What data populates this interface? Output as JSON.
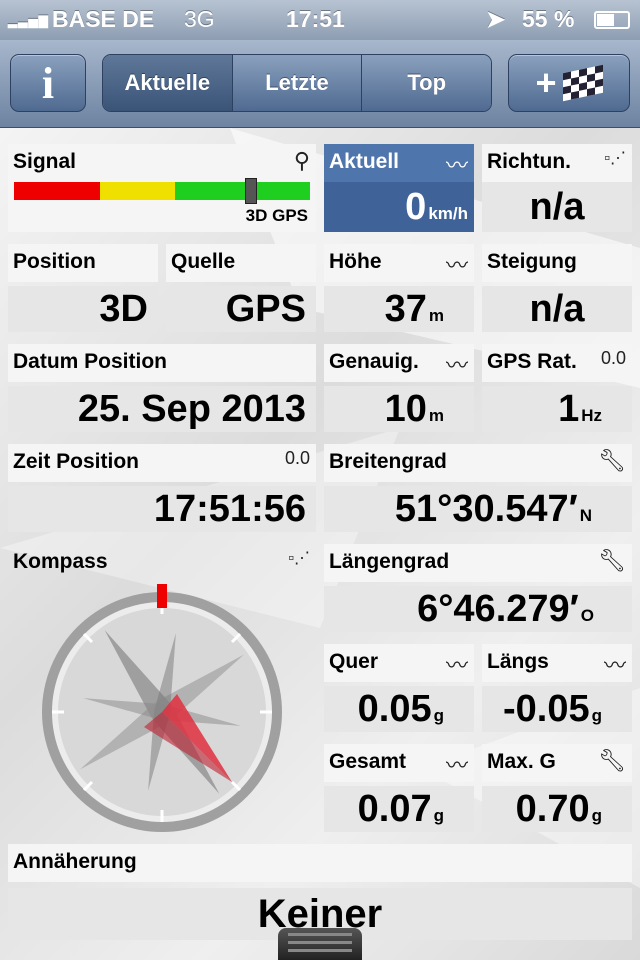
{
  "status_bar": {
    "carrier": "BASE DE",
    "network": "3G",
    "time": "17:51",
    "battery": "55 %"
  },
  "toolbar": {
    "info_label": "i",
    "tabs": [
      "Aktuelle",
      "Letzte",
      "Top"
    ],
    "active_tab": "Aktuelle",
    "add_label": "+"
  },
  "signal": {
    "label": "Signal",
    "status": "3D GPS",
    "level": 0.8
  },
  "speed": {
    "label": "Aktuell",
    "value": "0",
    "unit": "km/h"
  },
  "heading": {
    "label": "Richtun.",
    "value": "n/a"
  },
  "position": {
    "label": "Position",
    "value": "3D"
  },
  "source": {
    "label": "Quelle",
    "value": "GPS"
  },
  "altitude": {
    "label": "Höhe",
    "value": "37",
    "unit": "m"
  },
  "climb": {
    "label": "Steigung",
    "value": "n/a"
  },
  "date_position": {
    "label": "Datum Position",
    "value": "25. Sep 2013"
  },
  "accuracy": {
    "label": "Genauig.",
    "value": "10",
    "unit": "m"
  },
  "gps_rate": {
    "label": "GPS Rat.",
    "badge": "0.0",
    "value": "1",
    "unit": "Hz"
  },
  "time_position": {
    "label": "Zeit Position",
    "badge": "0.0",
    "value": "17:51:56"
  },
  "latitude": {
    "label": "Breitengrad",
    "value": "51°30.547′",
    "unit": "N"
  },
  "compass": {
    "label": "Kompass"
  },
  "longitude": {
    "label": "Längengrad",
    "value": "6°46.279′",
    "unit": "O"
  },
  "lateral": {
    "label": "Quer",
    "value": "0.05",
    "unit": "g"
  },
  "longitudinal": {
    "label": "Längs",
    "value": "-0.05",
    "unit": "g"
  },
  "total": {
    "label": "Gesamt",
    "value": "0.07",
    "unit": "g"
  },
  "max_g": {
    "label": "Max. G",
    "value": "0.70",
    "unit": "g"
  },
  "approach": {
    "label": "Annäherung",
    "value": "Keiner"
  }
}
